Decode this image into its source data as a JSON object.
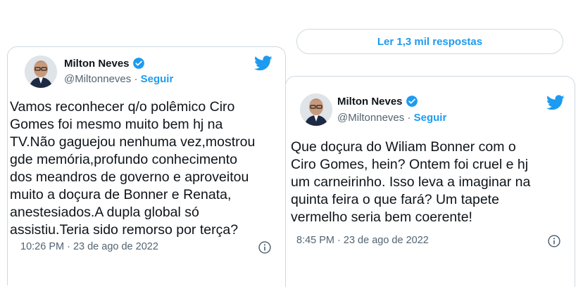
{
  "replies_button": {
    "label": "Ler 1,3 mil respostas"
  },
  "tweets": [
    {
      "name": "Milton Neves",
      "handle": "@Miltonneves",
      "separator": "·",
      "follow_label": "Seguir",
      "text": "Vamos reconhecer q/o polêmico Ciro\nGomes foi mesmo muito bem hj na\nTV.Não gaguejou nenhuma vez,mostrou\ngde memória,profundo conhecimento\ndos meandros de governo e aproveitou\nmuito a doçura de Bonner e Renata,\nanestesiados.A dupla global só\nassistiu.Teria sido remorso por terça?",
      "time": "10:26 PM · 23 de ago de 2022"
    },
    {
      "name": "Milton Neves",
      "handle": "@Miltonneves",
      "separator": "·",
      "follow_label": "Seguir",
      "text": "Que doçura do Wiliam Bonner com o\nCiro Gomes, hein? Ontem foi cruel e hj\num carneirinho. Isso leva a imaginar na\nquinta feira o que fará? Um tapete\nvermelho seria bem coerente!",
      "time": "8:45 PM · 23 de ago de 2022"
    }
  ],
  "colors": {
    "accent": "#1d9bf0",
    "secondary_text": "#536471",
    "border": "#cfd9de"
  },
  "icons": [
    "verified-badge-icon",
    "twitter-bird-icon",
    "info-icon"
  ]
}
